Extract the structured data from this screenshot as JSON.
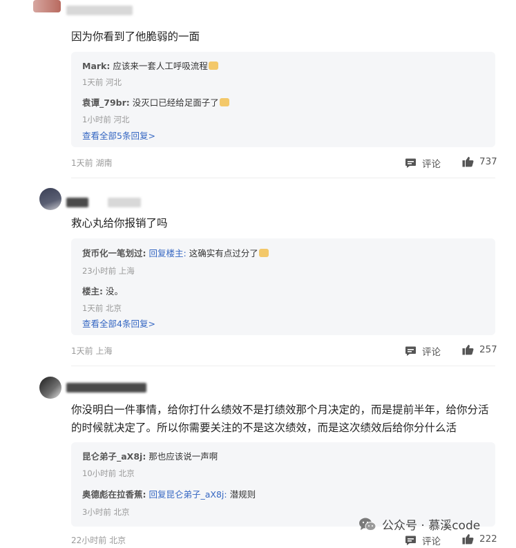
{
  "comments": [
    {
      "content": "因为你看到了他脆弱的一面",
      "replies": [
        {
          "user": "Mark",
          "sep": ":",
          "reply_to": "",
          "text": "应该来一套人工呼吸流程",
          "meta": "1天前 河北"
        },
        {
          "user": "袁谭_79br",
          "sep": ":",
          "reply_to": "",
          "text": "没灭口已经给足面子了",
          "meta": "1小时前 河北"
        }
      ],
      "view_all": "查看全部5条回复>",
      "meta": "1天前 湖南",
      "comment_label": "评论",
      "likes": "737"
    },
    {
      "content": "救心丸给你报销了吗",
      "replies": [
        {
          "user": "货币化一笔划过",
          "sep": ":",
          "reply_to": "回复楼主:",
          "text": "这确实有点过分了",
          "meta": "23小时前 上海"
        },
        {
          "user": "楼主",
          "sep": ":",
          "reply_to": "",
          "text": "没。",
          "meta": "1天前 北京"
        }
      ],
      "view_all": "查看全部4条回复>",
      "meta": "1天前 上海",
      "comment_label": "评论",
      "likes": "257"
    },
    {
      "content": "你没明白一件事情，给你打什么绩效不是打绩效那个月决定的，而是提前半年，给你分活的时候就决定了。所以你需要关注的不是这次绩效，而是这次绩效后给你分什么活",
      "replies": [
        {
          "user": "昆仑弟子_aX8j",
          "sep": ":",
          "reply_to": "",
          "text": "那也应该说一声啊",
          "meta": "10小时前 北京"
        },
        {
          "user": "奥德彪在拉香蕉",
          "sep": ":",
          "reply_to": "回复昆仑弟子_aX8j:",
          "text": "潜规则",
          "meta": "3小时前 北京"
        }
      ],
      "view_all": "",
      "meta": "22小时前 北京",
      "comment_label": "评论",
      "likes": "222"
    }
  ],
  "watermark": {
    "text": "公众号 · 慕溪code"
  },
  "icons": {
    "comment": "comment-icon",
    "like": "thumbs-up-icon",
    "watermark": "wechat-icon"
  }
}
